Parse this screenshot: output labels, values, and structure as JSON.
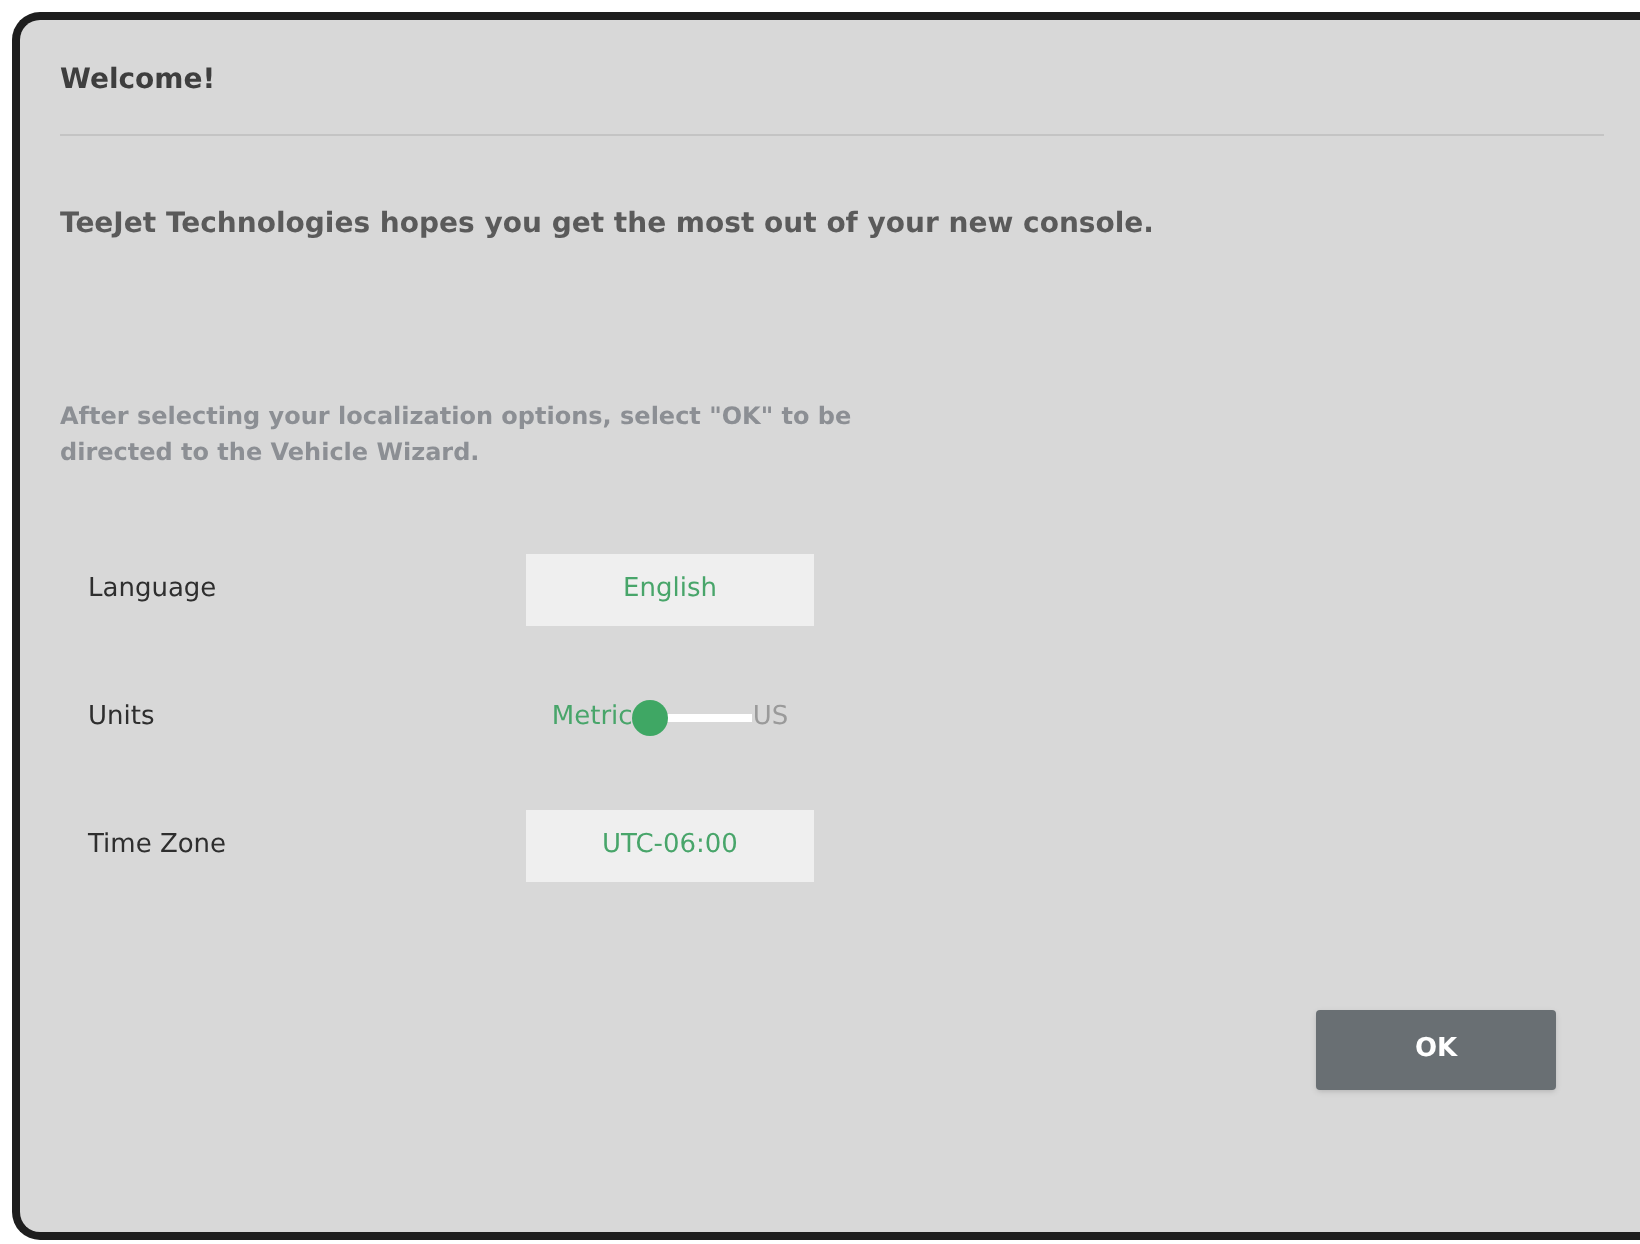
{
  "dialog": {
    "title": "Welcome!",
    "message": "TeeJet Technologies hopes you get the most out of your new console.",
    "instructions": "After selecting your localization options, select \"OK\" to be directed to the Vehicle Wizard.",
    "settings": [
      {
        "kind": "select",
        "label": "Language",
        "value": "English"
      },
      {
        "kind": "toggle",
        "label": "Units",
        "options": [
          {
            "label": "Metric",
            "selected": true
          },
          {
            "label": "US",
            "selected": false
          }
        ]
      },
      {
        "kind": "select",
        "label": "Time Zone",
        "value": "UTC-06:00"
      }
    ],
    "buttons": [
      "OK"
    ]
  }
}
